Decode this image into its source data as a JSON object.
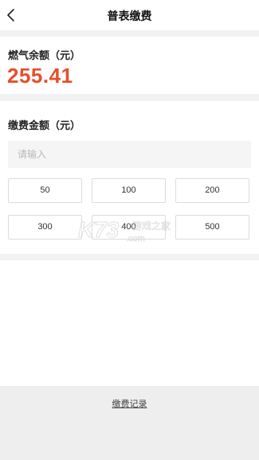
{
  "navbar": {
    "title": "普表缴费",
    "back_icon": "chevron-left-icon"
  },
  "balance": {
    "label": "燃气余额（元）",
    "value": "255.41",
    "value_color": "#e84e2a"
  },
  "payment": {
    "label": "缴费金额（元）",
    "input_placeholder": "请输入",
    "input_value": "",
    "amount_options": [
      "50",
      "100",
      "200",
      "300",
      "400",
      "500"
    ]
  },
  "watermark": {
    "text": "K73",
    "sub_text": "游戏之家",
    "domain": ".com"
  },
  "footer": {
    "records_label": "缴费记录"
  }
}
